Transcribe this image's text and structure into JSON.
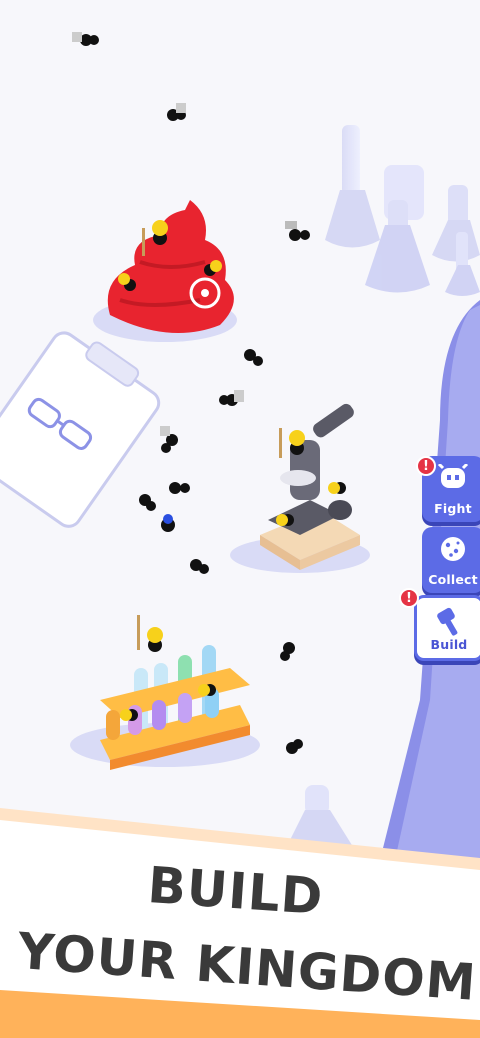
{
  "menu": {
    "fight": {
      "label": "Fight",
      "icon": "fight-bug-icon",
      "alert": "!"
    },
    "collect": {
      "label": "Collect",
      "icon": "cookie-icon"
    },
    "build": {
      "label": "Build",
      "icon": "hammer-icon",
      "alert": "!"
    }
  },
  "banner": {
    "line1": "BUILD",
    "line2": "YOUR KINGDOM"
  },
  "colors": {
    "accent": "#5c6be6",
    "alert": "#e53445",
    "blob": "#e8242f",
    "banner_text": "#3a3a3a"
  }
}
